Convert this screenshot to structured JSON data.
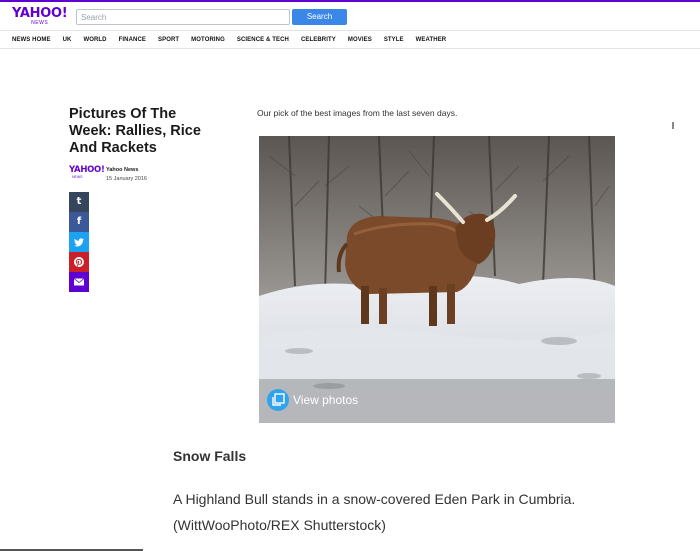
{
  "header": {
    "logo_text": "YAHOO!",
    "logo_sub": "NEWS",
    "search_placeholder": "Search",
    "search_button": "Search",
    "accent_color": "#5f01d1",
    "button_color": "#3b87e8"
  },
  "nav": {
    "items": [
      "NEWS HOME",
      "UK",
      "WORLD",
      "FINANCE",
      "SPORT",
      "MOTORING",
      "SCIENCE & TECH",
      "CELEBRITY",
      "MOVIES",
      "STYLE",
      "WEATHER"
    ]
  },
  "article": {
    "title": "Pictures Of The Week: Rallies, Rice And Rackets",
    "source_logo_text": "YAHOO!",
    "source_logo_sub": "NEWS",
    "author": "Yahoo News",
    "date": "15 January 2016",
    "intro": "Our pick of the best images from the last seven days."
  },
  "share": {
    "icons": [
      "tumblr-icon",
      "facebook-icon",
      "twitter-icon",
      "pinterest-icon",
      "mail-icon"
    ],
    "tumblr_glyph": "t",
    "facebook_glyph": "f"
  },
  "gallery": {
    "view_label": "View photos",
    "icon": "gallery-icon",
    "image_subject": "highland-bull-in-snow"
  },
  "caption": {
    "title": "Snow Falls",
    "text": "A Highland Bull stands in a snow-covered Eden Park in Cumbria. (WittWooPhoto/REX Shutterstock)"
  }
}
